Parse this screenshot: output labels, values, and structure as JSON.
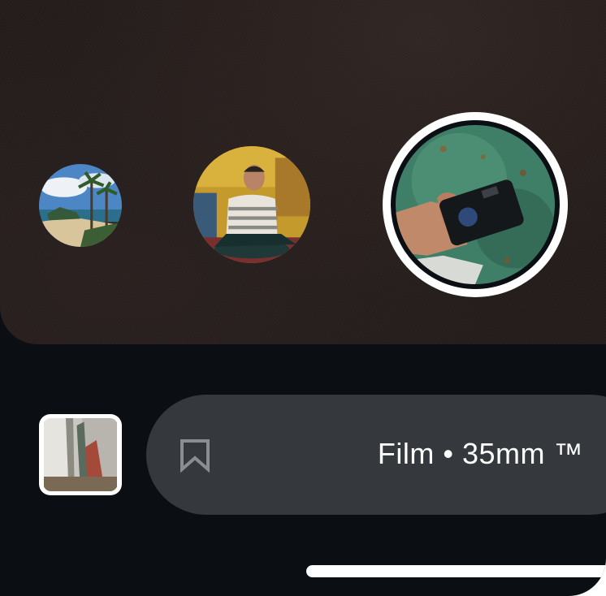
{
  "filters": {
    "items": [
      {
        "icon": "beach-preview-image",
        "selected": false
      },
      {
        "icon": "portrait-preview-image",
        "selected": false
      },
      {
        "icon": "camera-preview-image",
        "selected": true
      }
    ]
  },
  "bottom_bar": {
    "filter_name": "Film • 35mm ™",
    "bookmark_icon": "bookmark-outline-icon",
    "gallery_icon": "gallery-thumbnail-image"
  },
  "colors": {
    "background": "#0b0e12",
    "viewfinder": "#231b19",
    "pill": "#35383d",
    "text": "#ffffff",
    "bookmark_icon": "#8a8d92"
  }
}
